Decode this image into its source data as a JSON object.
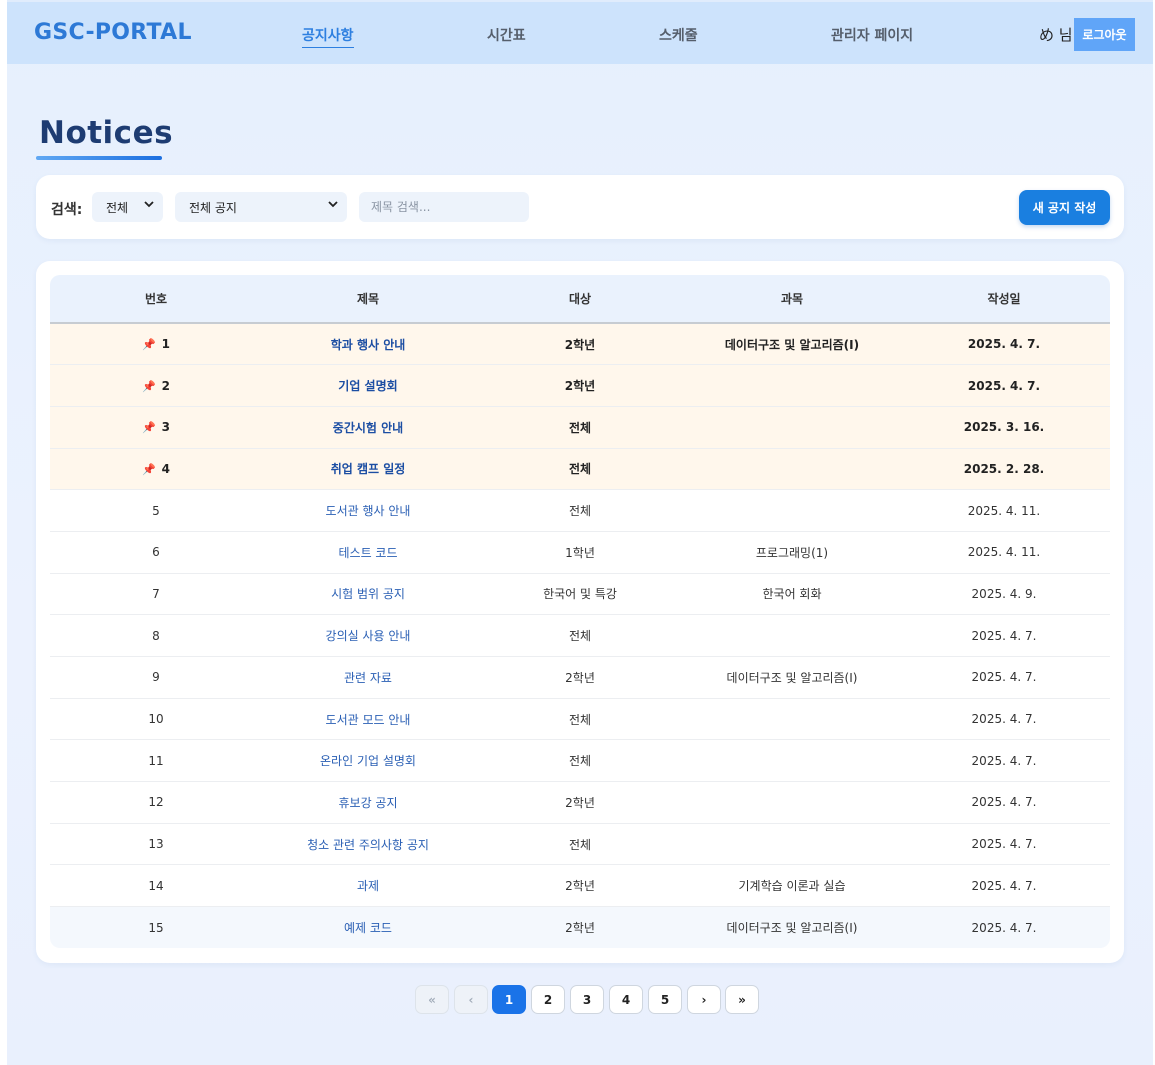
{
  "navbar": {
    "brand": "GSC-PORTAL",
    "links": [
      "공지사항",
      "시간표",
      "스케줄",
      "관리자 페이지"
    ],
    "user": "め 님",
    "logout": "로그아웃"
  },
  "page": {
    "title": "Notices"
  },
  "search": {
    "label": "검색:",
    "filter1": "전체",
    "filter2": "전체 공지",
    "placeholder": "제목 검색...",
    "new_button": "새 공지 작성"
  },
  "table": {
    "headers": [
      "번호",
      "제목",
      "대상",
      "과목",
      "작성일"
    ],
    "rows": [
      {
        "num": "1",
        "title": "학과 행사 안내",
        "target": "2학년",
        "subject": "데이터구조 및 알고리즘(I)",
        "date": "2025. 4. 7.",
        "pinned": true
      },
      {
        "num": "2",
        "title": "기업 설명회",
        "target": "2학년",
        "subject": "",
        "date": "2025. 4. 7.",
        "pinned": true
      },
      {
        "num": "3",
        "title": "중간시험 안내",
        "target": "전체",
        "subject": "",
        "date": "2025. 3. 16.",
        "pinned": true
      },
      {
        "num": "4",
        "title": "취업 캠프 일정",
        "target": "전체",
        "subject": "",
        "date": "2025. 2. 28.",
        "pinned": true
      },
      {
        "num": "5",
        "title": "도서관 행사 안내",
        "target": "전체",
        "subject": "",
        "date": "2025. 4. 11.",
        "pinned": false
      },
      {
        "num": "6",
        "title": "테스트 코드",
        "target": "1학년",
        "subject": "프로그래밍(1)",
        "date": "2025. 4. 11.",
        "pinned": false
      },
      {
        "num": "7",
        "title": "시험 범위 공지",
        "target": "한국어 및 특강",
        "subject": "한국어 회화",
        "date": "2025. 4. 9.",
        "pinned": false
      },
      {
        "num": "8",
        "title": "강의실 사용 안내",
        "target": "전체",
        "subject": "",
        "date": "2025. 4. 7.",
        "pinned": false
      },
      {
        "num": "9",
        "title": "관련 자료",
        "target": "2학년",
        "subject": "데이터구조 및 알고리즘(I)",
        "date": "2025. 4. 7.",
        "pinned": false
      },
      {
        "num": "10",
        "title": "도서관 모드 안내",
        "target": "전체",
        "subject": "",
        "date": "2025. 4. 7.",
        "pinned": false
      },
      {
        "num": "11",
        "title": "온라인 기업 설명회",
        "target": "전체",
        "subject": "",
        "date": "2025. 4. 7.",
        "pinned": false
      },
      {
        "num": "12",
        "title": "휴보강 공지",
        "target": "2학년",
        "subject": "",
        "date": "2025. 4. 7.",
        "pinned": false
      },
      {
        "num": "13",
        "title": "청소 관련 주의사항 공지",
        "target": "전체",
        "subject": "",
        "date": "2025. 4. 7.",
        "pinned": false
      },
      {
        "num": "14",
        "title": "과제",
        "target": "2학년",
        "subject": "기계학습 이론과 실습",
        "date": "2025. 4. 7.",
        "pinned": false
      },
      {
        "num": "15",
        "title": "예제 코드",
        "target": "2학년",
        "subject": "데이터구조 및 알고리즘(I)",
        "date": "2025. 4. 7.",
        "pinned": false
      }
    ]
  },
  "pagination": {
    "first": "«",
    "prev": "‹",
    "pages": [
      "1",
      "2",
      "3",
      "4",
      "5"
    ],
    "next": "›",
    "last": "»",
    "current": "1"
  },
  "colors": {
    "accent": "#1a73e8",
    "navbar": "#cde3fc",
    "pinned_row": "#fff7ec"
  },
  "icons": {
    "pin": "pushpin-icon",
    "dropdown": "chevron-down-icon"
  }
}
